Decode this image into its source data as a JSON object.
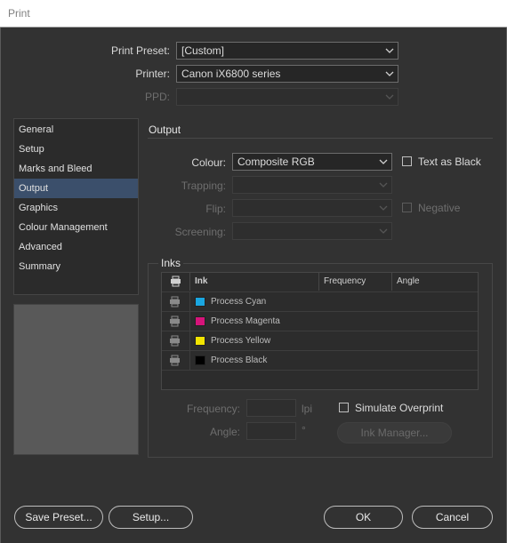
{
  "window": {
    "title": "Print"
  },
  "header": {
    "print_preset_label": "Print Preset:",
    "print_preset_value": "[Custom]",
    "printer_label": "Printer:",
    "printer_value": "Canon iX6800 series",
    "ppd_label": "PPD:",
    "ppd_value": ""
  },
  "sidebar": {
    "items": [
      {
        "label": "General"
      },
      {
        "label": "Setup"
      },
      {
        "label": "Marks and Bleed"
      },
      {
        "label": "Output"
      },
      {
        "label": "Graphics"
      },
      {
        "label": "Colour Management"
      },
      {
        "label": "Advanced"
      },
      {
        "label": "Summary"
      }
    ],
    "active": "Output"
  },
  "output": {
    "section_title": "Output",
    "colour_label": "Colour:",
    "colour_value": "Composite RGB",
    "trapping_label": "Trapping:",
    "flip_label": "Flip:",
    "screening_label": "Screening:",
    "text_as_black_label": "Text as Black",
    "text_as_black_checked": false,
    "negative_label": "Negative",
    "negative_checked": false
  },
  "inks": {
    "section_title": "Inks",
    "columns": {
      "ink": "Ink",
      "frequency": "Frequency",
      "angle": "Angle"
    },
    "rows": [
      {
        "name": "Process Cyan",
        "color": "#1aa6e0",
        "frequency": "",
        "angle": ""
      },
      {
        "name": "Process Magenta",
        "color": "#d6147a",
        "frequency": "",
        "angle": ""
      },
      {
        "name": "Process Yellow",
        "color": "#f2e400",
        "frequency": "",
        "angle": ""
      },
      {
        "name": "Process Black",
        "color": "#000000",
        "frequency": "",
        "angle": ""
      }
    ],
    "frequency_label": "Frequency:",
    "frequency_unit": "lpi",
    "frequency_value": "",
    "angle_label": "Angle:",
    "angle_unit": "°",
    "angle_value": "",
    "simulate_overprint_label": "Simulate Overprint",
    "simulate_overprint_checked": false,
    "ink_manager_label": "Ink Manager..."
  },
  "footer": {
    "save_preset_label": "Save Preset...",
    "setup_label": "Setup...",
    "ok_label": "OK",
    "cancel_label": "Cancel"
  },
  "colors": {
    "background": "#323232",
    "active_nav": "#3b4f6b",
    "preview_gray": "#595959"
  }
}
